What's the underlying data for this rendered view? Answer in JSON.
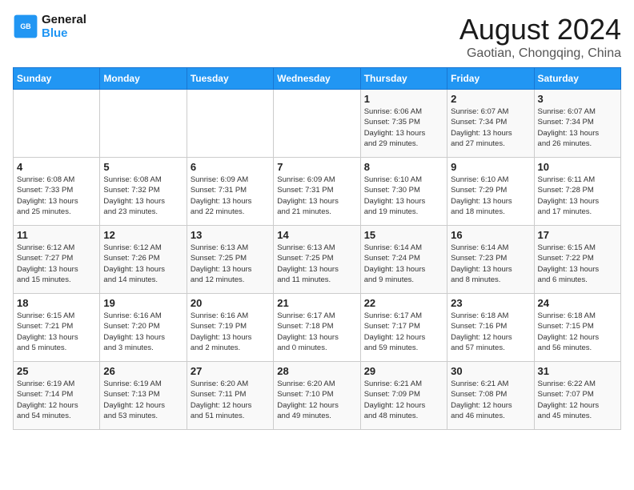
{
  "header": {
    "logo_line1": "General",
    "logo_line2": "Blue",
    "month_year": "August 2024",
    "location": "Gaotian, Chongqing, China"
  },
  "weekdays": [
    "Sunday",
    "Monday",
    "Tuesday",
    "Wednesday",
    "Thursday",
    "Friday",
    "Saturday"
  ],
  "weeks": [
    [
      {
        "day": "",
        "text": ""
      },
      {
        "day": "",
        "text": ""
      },
      {
        "day": "",
        "text": ""
      },
      {
        "day": "",
        "text": ""
      },
      {
        "day": "1",
        "text": "Sunrise: 6:06 AM\nSunset: 7:35 PM\nDaylight: 13 hours\nand 29 minutes."
      },
      {
        "day": "2",
        "text": "Sunrise: 6:07 AM\nSunset: 7:34 PM\nDaylight: 13 hours\nand 27 minutes."
      },
      {
        "day": "3",
        "text": "Sunrise: 6:07 AM\nSunset: 7:34 PM\nDaylight: 13 hours\nand 26 minutes."
      }
    ],
    [
      {
        "day": "4",
        "text": "Sunrise: 6:08 AM\nSunset: 7:33 PM\nDaylight: 13 hours\nand 25 minutes."
      },
      {
        "day": "5",
        "text": "Sunrise: 6:08 AM\nSunset: 7:32 PM\nDaylight: 13 hours\nand 23 minutes."
      },
      {
        "day": "6",
        "text": "Sunrise: 6:09 AM\nSunset: 7:31 PM\nDaylight: 13 hours\nand 22 minutes."
      },
      {
        "day": "7",
        "text": "Sunrise: 6:09 AM\nSunset: 7:31 PM\nDaylight: 13 hours\nand 21 minutes."
      },
      {
        "day": "8",
        "text": "Sunrise: 6:10 AM\nSunset: 7:30 PM\nDaylight: 13 hours\nand 19 minutes."
      },
      {
        "day": "9",
        "text": "Sunrise: 6:10 AM\nSunset: 7:29 PM\nDaylight: 13 hours\nand 18 minutes."
      },
      {
        "day": "10",
        "text": "Sunrise: 6:11 AM\nSunset: 7:28 PM\nDaylight: 13 hours\nand 17 minutes."
      }
    ],
    [
      {
        "day": "11",
        "text": "Sunrise: 6:12 AM\nSunset: 7:27 PM\nDaylight: 13 hours\nand 15 minutes."
      },
      {
        "day": "12",
        "text": "Sunrise: 6:12 AM\nSunset: 7:26 PM\nDaylight: 13 hours\nand 14 minutes."
      },
      {
        "day": "13",
        "text": "Sunrise: 6:13 AM\nSunset: 7:25 PM\nDaylight: 13 hours\nand 12 minutes."
      },
      {
        "day": "14",
        "text": "Sunrise: 6:13 AM\nSunset: 7:25 PM\nDaylight: 13 hours\nand 11 minutes."
      },
      {
        "day": "15",
        "text": "Sunrise: 6:14 AM\nSunset: 7:24 PM\nDaylight: 13 hours\nand 9 minutes."
      },
      {
        "day": "16",
        "text": "Sunrise: 6:14 AM\nSunset: 7:23 PM\nDaylight: 13 hours\nand 8 minutes."
      },
      {
        "day": "17",
        "text": "Sunrise: 6:15 AM\nSunset: 7:22 PM\nDaylight: 13 hours\nand 6 minutes."
      }
    ],
    [
      {
        "day": "18",
        "text": "Sunrise: 6:15 AM\nSunset: 7:21 PM\nDaylight: 13 hours\nand 5 minutes."
      },
      {
        "day": "19",
        "text": "Sunrise: 6:16 AM\nSunset: 7:20 PM\nDaylight: 13 hours\nand 3 minutes."
      },
      {
        "day": "20",
        "text": "Sunrise: 6:16 AM\nSunset: 7:19 PM\nDaylight: 13 hours\nand 2 minutes."
      },
      {
        "day": "21",
        "text": "Sunrise: 6:17 AM\nSunset: 7:18 PM\nDaylight: 13 hours\nand 0 minutes."
      },
      {
        "day": "22",
        "text": "Sunrise: 6:17 AM\nSunset: 7:17 PM\nDaylight: 12 hours\nand 59 minutes."
      },
      {
        "day": "23",
        "text": "Sunrise: 6:18 AM\nSunset: 7:16 PM\nDaylight: 12 hours\nand 57 minutes."
      },
      {
        "day": "24",
        "text": "Sunrise: 6:18 AM\nSunset: 7:15 PM\nDaylight: 12 hours\nand 56 minutes."
      }
    ],
    [
      {
        "day": "25",
        "text": "Sunrise: 6:19 AM\nSunset: 7:14 PM\nDaylight: 12 hours\nand 54 minutes."
      },
      {
        "day": "26",
        "text": "Sunrise: 6:19 AM\nSunset: 7:13 PM\nDaylight: 12 hours\nand 53 minutes."
      },
      {
        "day": "27",
        "text": "Sunrise: 6:20 AM\nSunset: 7:11 PM\nDaylight: 12 hours\nand 51 minutes."
      },
      {
        "day": "28",
        "text": "Sunrise: 6:20 AM\nSunset: 7:10 PM\nDaylight: 12 hours\nand 49 minutes."
      },
      {
        "day": "29",
        "text": "Sunrise: 6:21 AM\nSunset: 7:09 PM\nDaylight: 12 hours\nand 48 minutes."
      },
      {
        "day": "30",
        "text": "Sunrise: 6:21 AM\nSunset: 7:08 PM\nDaylight: 12 hours\nand 46 minutes."
      },
      {
        "day": "31",
        "text": "Sunrise: 6:22 AM\nSunset: 7:07 PM\nDaylight: 12 hours\nand 45 minutes."
      }
    ]
  ]
}
